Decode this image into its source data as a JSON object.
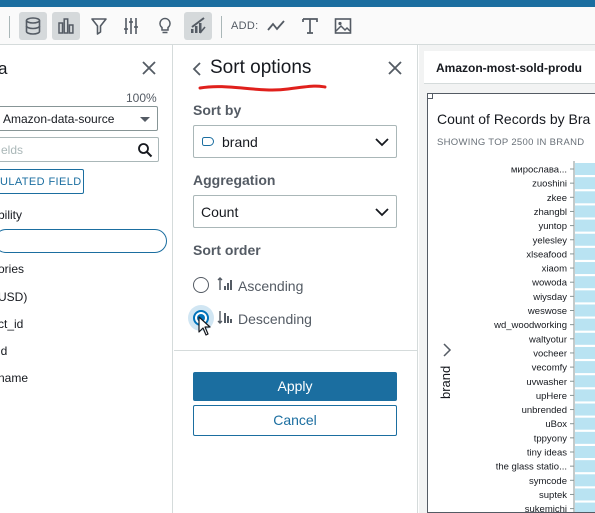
{
  "toolbar": {
    "add_label": "ADD:",
    "buttons": [
      "data-icon",
      "visualize-icon",
      "filter-icon",
      "parameters-icon",
      "insights-icon",
      "format-icon",
      "line-icon",
      "text-icon",
      "image-icon"
    ]
  },
  "data_pane": {
    "title": "a",
    "percent": "100%",
    "dataset": "Amazon-data-source",
    "search_placeholder": "elds",
    "calc_field_button": "ULATED FIELD",
    "fields": [
      "bility",
      "",
      "ories",
      "USD)",
      "ct_id",
      "id",
      "name"
    ]
  },
  "sort_panel": {
    "title": "Sort options",
    "sort_by_label": "Sort by",
    "sort_by_value": "brand",
    "aggregation_label": "Aggregation",
    "aggregation_value": "Count",
    "sort_order_label": "Sort order",
    "options": [
      {
        "label": "Ascending",
        "checked": false
      },
      {
        "label": "Descending",
        "checked": true
      }
    ],
    "apply_label": "Apply",
    "cancel_label": "Cancel",
    "annotation_color": "#e0201c"
  },
  "canvas": {
    "tab_label": "Amazon-most-sold-produ"
  },
  "chart_data": {
    "type": "bar",
    "orientation": "horizontal",
    "title": "Count of Records by Bra",
    "subtitle": "SHOWING TOP 2500 IN BRAND",
    "ylabel": "brand",
    "categories": [
      "мирослава...",
      "zuoshini",
      "zkee",
      "zhangbl",
      "yuntop",
      "yelesley",
      "xlseafood",
      "xiaom",
      "wowoda",
      "wiysday",
      "weswose",
      "wd_woodworking",
      "waltyotur",
      "vocheer",
      "vecomfy",
      "uvwasher",
      "upHere",
      "unbrended",
      "uBox",
      "tppyony",
      "tiny ideas",
      "the glass statio...",
      "symcode",
      "suptek",
      "sukemichi"
    ],
    "values": [
      1,
      1,
      1,
      1,
      1,
      1,
      1,
      1,
      1,
      1,
      1,
      1,
      1,
      1,
      1,
      1,
      1,
      1,
      1,
      1,
      1,
      1,
      1,
      1,
      1
    ],
    "bar_color": "#b9e3f2"
  }
}
